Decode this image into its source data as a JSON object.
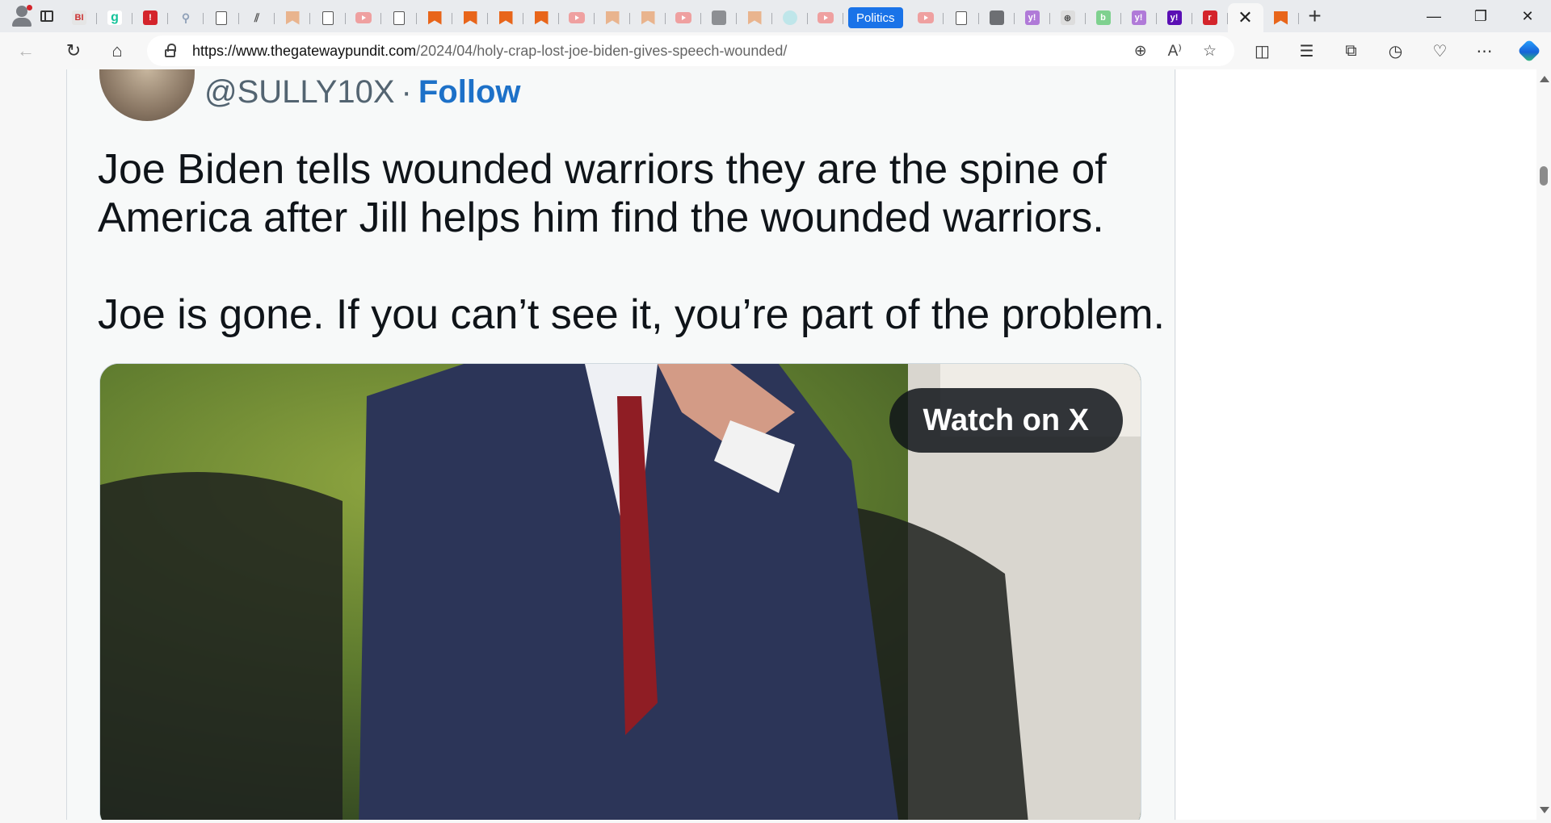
{
  "browser": {
    "active_tab_close": "✕",
    "pinned_tab_label": "Politics",
    "new_tab": "+",
    "window": {
      "minimize": "—",
      "restore": "❐",
      "close": "✕"
    },
    "address_bar": {
      "url_host": "https://www.thegatewaypundit.com",
      "url_path": "/2024/04/holy-crap-lost-joe-biden-gives-speech-wounded/"
    },
    "colors": {
      "politics_tab": "#1a73e8",
      "follow_link": "#1d71c8"
    }
  },
  "tweet": {
    "handle": "@SULLY10X",
    "separator": "·",
    "follow_label": "Follow",
    "paragraphs": [
      "Joe Biden tells wounded warriors they are the spine of America after Jill helps him find the wounded warriors.",
      "Joe is gone. If you can’t see it, you’re part of the problem."
    ],
    "watch_label": "Watch on X"
  }
}
